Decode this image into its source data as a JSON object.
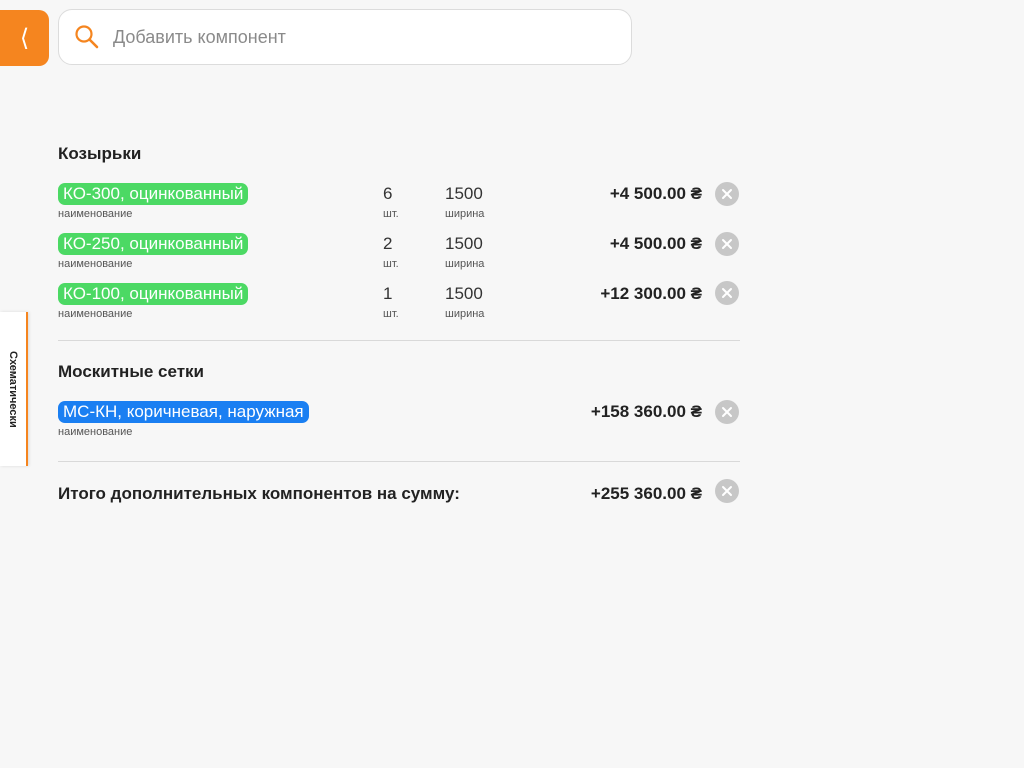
{
  "header": {
    "back_label": "⟨",
    "search": {
      "placeholder": "Добавить компонент",
      "value": ""
    }
  },
  "side_tab": {
    "label": "Схематически"
  },
  "sections": [
    {
      "title": "Козырьки",
      "items": [
        {
          "name": "КО-300, оцинкованный",
          "name_caption": "наименование",
          "qty": "6",
          "qty_caption": "шт.",
          "width": "1500",
          "width_caption": "ширина",
          "price": "+4 500.00 ₴"
        },
        {
          "name": "КО-250, оцинкованный",
          "name_caption": "наименование",
          "qty": "2",
          "qty_caption": "шт.",
          "width": "1500",
          "width_caption": "ширина",
          "price": "+4 500.00 ₴"
        },
        {
          "name": "КО-100, оцинкованный",
          "name_caption": "наименование",
          "qty": "1",
          "qty_caption": "шт.",
          "width": "1500",
          "width_caption": "ширина",
          "price": "+12 300.00 ₴"
        }
      ]
    },
    {
      "title": "Москитные сетки",
      "items": [
        {
          "name": "МС-КН, коричневая, наружная",
          "name_caption": "наименование",
          "price": "+158 360.00 ₴"
        }
      ]
    }
  ],
  "total": {
    "label": "Итого дополнительных компонентов на сумму:",
    "price": "+255 360.00 ₴"
  },
  "colors": {
    "accent": "#f5851f",
    "pill_green": "#4cd964",
    "pill_blue": "#1a7ff2",
    "remove_gray": "#c7c7c7"
  }
}
